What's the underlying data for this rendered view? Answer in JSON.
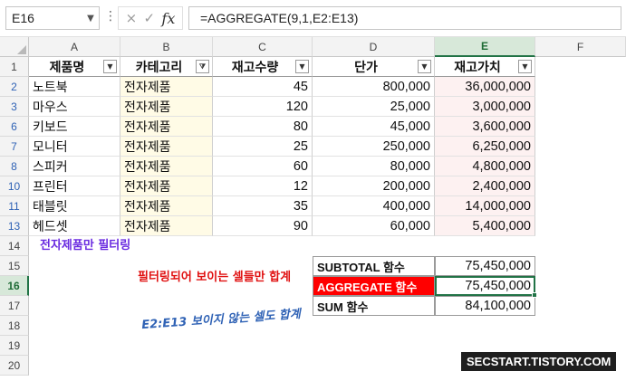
{
  "formula_bar": {
    "name_box": "E16",
    "cancel_icon": "×",
    "enter_icon": "✓",
    "fx_label": "fx",
    "formula": "=AGGREGATE(9,1,E2:E13)"
  },
  "columns": [
    "A",
    "B",
    "C",
    "D",
    "E",
    "F"
  ],
  "selected_column": "E",
  "rows": [
    "1",
    "2",
    "3",
    "6",
    "7",
    "8",
    "10",
    "11",
    "13",
    "14",
    "15",
    "16",
    "17",
    "18",
    "19",
    "20"
  ],
  "selected_row": "16",
  "table": {
    "headers": [
      "제품명",
      "카테고리",
      "재고수량",
      "단가",
      "재고가치"
    ],
    "filter_active_column": "카테고리",
    "data": [
      [
        "노트북",
        "전자제품",
        "45",
        "800,000",
        "36,000,000"
      ],
      [
        "마우스",
        "전자제품",
        "120",
        "25,000",
        "3,000,000"
      ],
      [
        "키보드",
        "전자제품",
        "80",
        "45,000",
        "3,600,000"
      ],
      [
        "모니터",
        "전자제품",
        "25",
        "250,000",
        "6,250,000"
      ],
      [
        "스피커",
        "전자제품",
        "60",
        "80,000",
        "4,800,000"
      ],
      [
        "프린터",
        "전자제품",
        "12",
        "200,000",
        "2,400,000"
      ],
      [
        "태블릿",
        "전자제품",
        "35",
        "400,000",
        "14,000,000"
      ],
      [
        "헤드셋",
        "전자제품",
        "90",
        "60,000",
        "5,400,000"
      ]
    ]
  },
  "summary": [
    {
      "label": "SUBTOTAL 함수",
      "value": "75,450,000"
    },
    {
      "label": "AGGREGATE 함수",
      "value": "75,450,000"
    },
    {
      "label": "SUM 함수",
      "value": "84,100,000"
    }
  ],
  "annotations": {
    "filter_note": "전자제품만 필터링",
    "visible_note": "필터링되어 보이는 셀들만 합계",
    "hidden_note": "E2:E13 보이지 않는 셀도 합계"
  },
  "watermark": "SECSTART.TISTORY.COM",
  "colors": {
    "accent": "#217346",
    "highlight_red": "#ff0000"
  }
}
